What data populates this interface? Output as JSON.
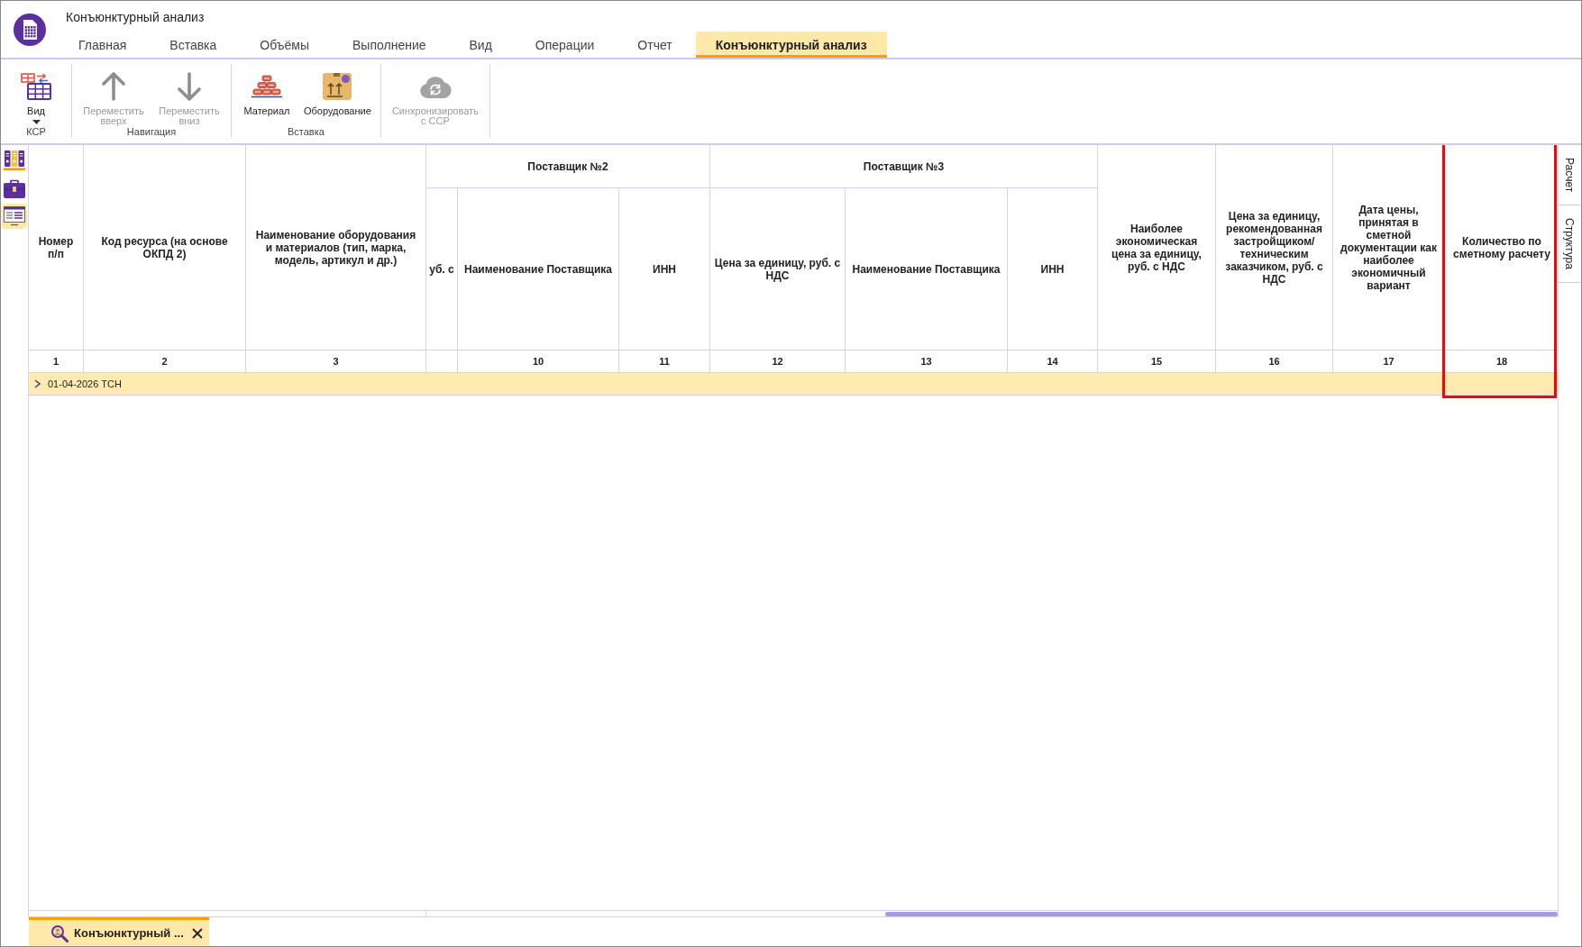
{
  "window": {
    "title": "Конъюнктурный анализ"
  },
  "tabs": [
    {
      "label": "Главная",
      "selected": false
    },
    {
      "label": "Вставка",
      "selected": false
    },
    {
      "label": "Объёмы",
      "selected": false
    },
    {
      "label": "Выполнение",
      "selected": false
    },
    {
      "label": "Вид",
      "selected": false
    },
    {
      "label": "Операции",
      "selected": false
    },
    {
      "label": "Отчет",
      "selected": false
    },
    {
      "label": "Конъюнктурный анализ",
      "selected": true
    }
  ],
  "ribbon": {
    "groups": [
      {
        "label": "КСР",
        "buttons": [
          {
            "kind": "view",
            "label": "Вид",
            "dropdown": true,
            "disabled": false
          }
        ]
      },
      {
        "label": "Навигация",
        "buttons": [
          {
            "kind": "move-up",
            "label": "Переместить вверх",
            "dropdown": false,
            "disabled": true
          },
          {
            "kind": "move-down",
            "label": "Переместить вниз",
            "dropdown": false,
            "disabled": true
          }
        ]
      },
      {
        "label": "Вставка",
        "buttons": [
          {
            "kind": "material",
            "label": "Материал",
            "dropdown": false,
            "disabled": false
          },
          {
            "kind": "equipment",
            "label": "Оборудование",
            "dropdown": false,
            "disabled": false
          }
        ]
      },
      {
        "buttons": [
          {
            "kind": "sync",
            "label": "Синхронизировать с ССР",
            "dropdown": false,
            "disabled": true
          }
        ]
      }
    ]
  },
  "sidebar": {
    "items": [
      {
        "kind": "binders",
        "selected": false
      },
      {
        "kind": "briefcase",
        "selected": false
      },
      {
        "kind": "form",
        "selected": true
      }
    ]
  },
  "table": {
    "columns": [
      {
        "header": "Номер п/п",
        "number": "1",
        "highlighted": false
      },
      {
        "header": "Код ресурса (на основе ОКПД 2)",
        "number": "2",
        "highlighted": false
      },
      {
        "header": "Наименование оборудования и материалов (тип, марка, модель, артикул и др.)",
        "number": "3",
        "highlighted": false
      },
      {
        "header": "Поставщик №2",
        "children": [
          {
            "header": "уб. с",
            "highlighted": false
          },
          {
            "header": "Наименование Поставщика",
            "number": "10",
            "highlighted": false
          },
          {
            "header": "ИНН",
            "number": "11",
            "highlighted": false
          }
        ]
      },
      {
        "header": "Поставщик №3",
        "children": [
          {
            "header": "Цена за единицу, руб. с НДС",
            "number": "12",
            "highlighted": false
          },
          {
            "header": "Наименование Поставщика",
            "number": "13",
            "highlighted": false
          },
          {
            "header": "ИНН",
            "number": "14",
            "highlighted": false
          }
        ]
      },
      {
        "header": "Наиболее экономическая цена за единицу, руб. с НДС",
        "number": "15",
        "highlighted": false
      },
      {
        "header": "Цена за единицу, рекомендованная застройщиком/ техническим заказчиком, руб. с НДС",
        "number": "16",
        "highlighted": false
      },
      {
        "header": "Дата цены, принятая в сметной документации как наиболее экономичный вариант",
        "number": "17",
        "highlighted": false
      },
      {
        "header": "Количество по сметному расчету",
        "number": "18",
        "highlighted": true
      }
    ],
    "rows": [
      {
        "label": "01-04-2026 ТСН",
        "expanded": false
      }
    ]
  },
  "side_tabs": [
    {
      "label": "Расчет"
    },
    {
      "label": "Структура"
    }
  ],
  "document_tabs": [
    {
      "label": "Конъюнктурный ...",
      "selected": true
    }
  ]
}
